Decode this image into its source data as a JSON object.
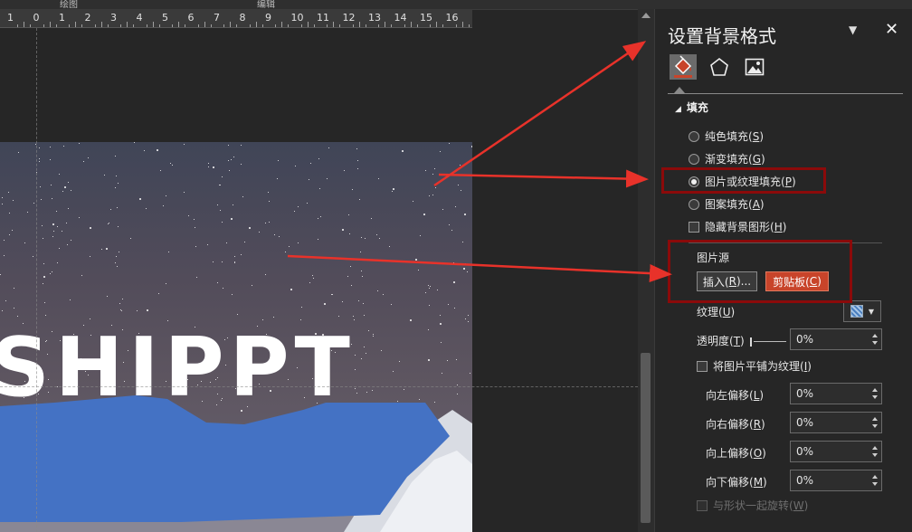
{
  "top_strip": {
    "left_label": "绘图",
    "right_label": "编辑"
  },
  "ruler": {
    "numbers": [
      "1",
      "0",
      "1",
      "2",
      "3",
      "4",
      "5",
      "6",
      "7",
      "8",
      "9",
      "10",
      "11",
      "12",
      "13",
      "14",
      "15",
      "16"
    ]
  },
  "slide": {
    "text": "SHIPPT",
    "shape_color": "#4472c4"
  },
  "panel": {
    "title": "设置背景格式",
    "dropdown_icon": "triangle-down-icon",
    "close_icon": "close-icon",
    "tabs": [
      {
        "name": "fill-tab",
        "icon": "paint-bucket-icon",
        "active": true
      },
      {
        "name": "effects-tab",
        "icon": "pentagon-icon",
        "active": false
      },
      {
        "name": "picture-tab",
        "icon": "picture-icon",
        "active": false
      }
    ],
    "section_title": "填充",
    "fill_options": [
      {
        "pre": "纯色填充(",
        "key": "S",
        "post": ")"
      },
      {
        "pre": "渐变填充(",
        "key": "G",
        "post": ")"
      },
      {
        "pre": "图片或纹理填充(",
        "key": "P",
        "post": ")"
      },
      {
        "pre": "图案填充(",
        "key": "A",
        "post": ")"
      }
    ],
    "selected_fill_index": 2,
    "hide_graphics": {
      "pre": "隐藏背景图形(",
      "key": "H",
      "post": ")"
    },
    "picture_source_label": "图片源",
    "insert_button": {
      "pre": "插入(",
      "key": "R",
      "post": ")..."
    },
    "clipboard_button": {
      "pre": "剪贴板(",
      "key": "C",
      "post": ")"
    },
    "texture_label": {
      "pre": "纹理(",
      "key": "U",
      "post": ")"
    },
    "transparency_label": {
      "pre": "透明度(",
      "key": "T",
      "post": ")"
    },
    "transparency_value": "0%",
    "tile_label": {
      "pre": "将图片平铺为纹理(",
      "key": "I",
      "post": ")"
    },
    "offsets": [
      {
        "pre": "向左偏移(",
        "key": "L",
        "post": ")",
        "value": "0%"
      },
      {
        "pre": "向右偏移(",
        "key": "R",
        "post": ")",
        "value": "0%"
      },
      {
        "pre": "向上偏移(",
        "key": "O",
        "post": ")",
        "value": "0%"
      },
      {
        "pre": "向下偏移(",
        "key": "M",
        "post": ")",
        "value": "0%"
      }
    ],
    "rotate_label": {
      "pre": "与形状一起旋转(",
      "key": "W",
      "post": ")"
    }
  },
  "colors": {
    "accent_button": "#c8442a",
    "annotation_box": "#8b0a0a",
    "annotation_arrow": "#e8322a"
  }
}
